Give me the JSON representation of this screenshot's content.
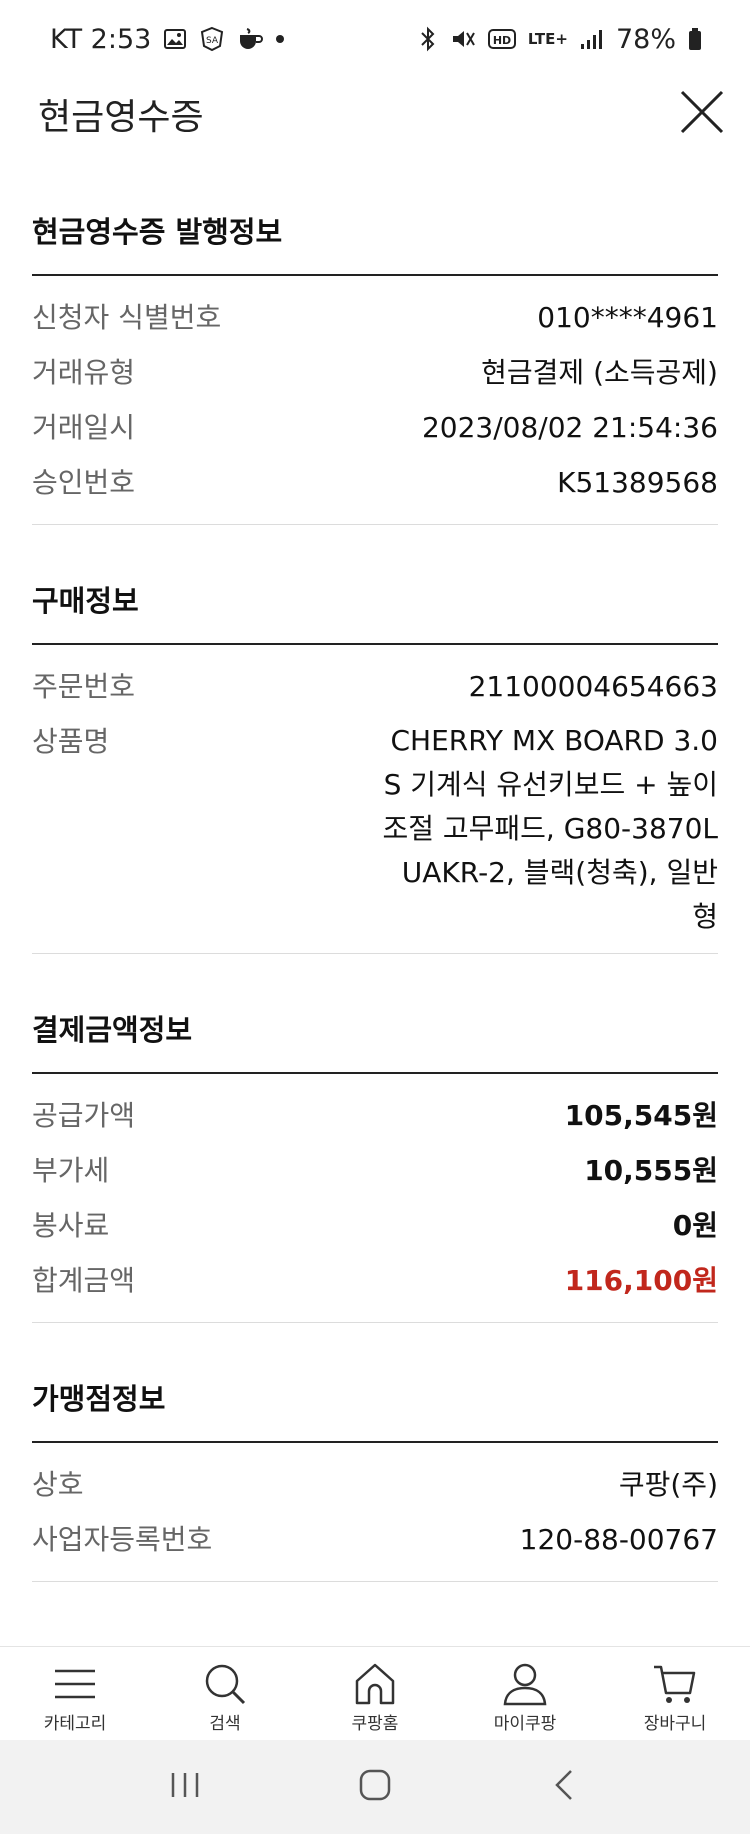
{
  "statusbar": {
    "carrier_time": "KT 2:53",
    "network": "LTE+",
    "battery": "78%"
  },
  "header": {
    "title": "현금영수증",
    "close_icon": "close-icon"
  },
  "issue_info": {
    "title": "현금영수증 발행정보",
    "rows": [
      {
        "label": "신청자 식별번호",
        "value": "010****4961"
      },
      {
        "label": "거래유형",
        "value": "현금결제 (소득공제)"
      },
      {
        "label": "거래일시",
        "value": "2023/08/02 21:54:36"
      },
      {
        "label": "승인번호",
        "value": "K51389568"
      }
    ]
  },
  "purchase_info": {
    "title": "구매정보",
    "order_label": "주문번호",
    "order_value": "21100004654663",
    "product_label": "상품명",
    "product_value": "CHERRY MX BOARD 3.0 S 기계식 유선키보드 + 높이조절 고무패드, G80-3870LUAKR-2, 블랙(청축), 일반형"
  },
  "payment_info": {
    "title": "결제금액정보",
    "rows": [
      {
        "label": "공급가액",
        "value": "105,545원"
      },
      {
        "label": "부가세",
        "value": "10,555원"
      },
      {
        "label": "봉사료",
        "value": "0원"
      }
    ],
    "total_label": "합계금액",
    "total_value": "116,100원",
    "total_color": "#c1271c"
  },
  "merchant_info": {
    "title": "가맹점정보",
    "rows": [
      {
        "label": "상호",
        "value": "쿠팡(주)"
      },
      {
        "label": "사업자등록번호",
        "value": "120-88-00767"
      }
    ]
  },
  "bottom_nav": [
    {
      "label": "카테고리",
      "icon": "menu-icon"
    },
    {
      "label": "검색",
      "icon": "search-icon"
    },
    {
      "label": "쿠팡홈",
      "icon": "home-icon"
    },
    {
      "label": "마이쿠팡",
      "icon": "user-icon"
    },
    {
      "label": "장바구니",
      "icon": "cart-icon"
    }
  ],
  "system_nav": [
    "recent-apps-icon",
    "home-circle-icon",
    "back-icon"
  ]
}
